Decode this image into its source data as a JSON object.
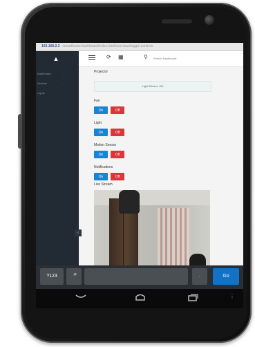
{
  "browser": {
    "url_host": "192.168.2.3",
    "url_path": "/smarthome/dashboard/index.html/overview/toggle-controls"
  },
  "sidebar": {
    "home_icon": "home-icon",
    "items": [
      {
        "label": "Dashboard"
      },
      {
        "label": "Devices"
      },
      {
        "label": "Lights"
      }
    ]
  },
  "topbar": {
    "menu_icon": "menu-icon",
    "refresh_icon": "refresh-icon",
    "grid_icon": "grid-icon",
    "search_icon": "search-icon",
    "search_placeholder": "Search Dashboard"
  },
  "controls": {
    "projector_label": "Projector",
    "light_sensor_status": "Light Sensor: ON",
    "fan_label": "Fan",
    "light_label": "Light",
    "motion_sensor_label": "Motion Sensor",
    "notifications_label": "Notifications",
    "live_stream_label": "Live Stream",
    "on_label": "On",
    "off_label": "Off",
    "on_color": "#1a84d4",
    "off_color": "#d9373c"
  },
  "keyboard": {
    "numeric_key": "?123",
    "mic_icon": "microphone-icon",
    "period_key": ".",
    "go_key": "Go"
  },
  "navbar": {
    "back_icon": "back-icon",
    "home_icon": "home-button-icon",
    "recents_icon": "recents-icon",
    "more_icon": "more-icon"
  }
}
